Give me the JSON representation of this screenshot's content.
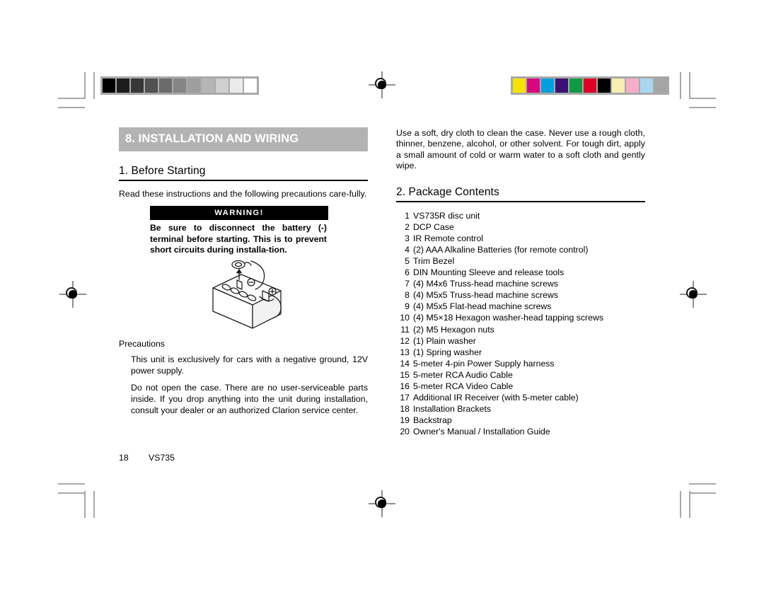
{
  "document": {
    "footer": {
      "page_number": "18",
      "model": "VS735"
    }
  },
  "left_column": {
    "section_band": "8. INSTALLATION AND WIRING",
    "heading": "1. Before Starting",
    "intro": "Read these instructions and the following precautions care-fully.",
    "warning": {
      "title": "WARNING!",
      "text": "Be sure to disconnect the battery (-) terminal before starting. This is to prevent short circuits during installa-tion."
    },
    "illustration_name": "car-battery-disconnect-negative-terminal",
    "precautions_label": "Precautions",
    "precautions": [
      "This unit is exclusively for cars with a negative ground, 12V power supply.",
      "Do not open the case. There are no user-serviceable parts inside. If you drop anything into the unit during installation, consult your dealer or an authorized Clarion service center."
    ]
  },
  "right_column": {
    "cleaning_note": "Use a soft, dry cloth to clean the case. Never use a rough cloth, thinner, benzene, alcohol, or other solvent. For tough dirt, apply a small amount of cold or warm water to a soft cloth and gently wipe.",
    "heading": "2. Package Contents",
    "items": [
      {
        "num": "1",
        "text": "VS735R disc unit"
      },
      {
        "num": "2",
        "text": "DCP Case"
      },
      {
        "num": "3",
        "text": "IR Remote control"
      },
      {
        "num": "4",
        "text": "(2) AAA Alkaline Batteries (for remote control)"
      },
      {
        "num": "5",
        "text": "Trim Bezel"
      },
      {
        "num": "6",
        "text": "DIN Mounting Sleeve and release tools"
      },
      {
        "num": "7",
        "text": "(4) M4x6 Truss-head machine screws"
      },
      {
        "num": "8",
        "text": "(4) M5x5 Truss-head machine screws"
      },
      {
        "num": "9",
        "text": "(4) M5x5 Flat-head machine screws"
      },
      {
        "num": "10",
        "text": "(4) M5×18 Hexagon washer-head tapping screws"
      },
      {
        "num": "11",
        "text": "(2) M5 Hexagon nuts"
      },
      {
        "num": "12",
        "text": "(1) Plain washer"
      },
      {
        "num": "13",
        "text": "(1) Spring washer"
      },
      {
        "num": "14",
        "text": "5-meter 4-pin Power Supply harness"
      },
      {
        "num": "15",
        "text": "5-meter RCA Audio Cable"
      },
      {
        "num": "16",
        "text": "5-meter RCA Video Cable"
      },
      {
        "num": "17",
        "text": "Additional IR Receiver (with 5-meter cable)"
      },
      {
        "num": "18",
        "text": "Installation Brackets"
      },
      {
        "num": "19",
        "text": "Backstrap"
      },
      {
        "num": "20",
        "text": "Owner's Manual / Installation Guide"
      }
    ]
  },
  "printer_marks": {
    "grayscale_strip": [
      "#000000",
      "#1c1c1c",
      "#383838",
      "#525252",
      "#6b6b6b",
      "#858585",
      "#9e9e9e",
      "#b5b5b5",
      "#cfcfcf",
      "#ebebeb",
      "#ffffff"
    ],
    "color_strip": [
      "#f5e400",
      "#d8077f",
      "#00a0df",
      "#3a1273",
      "#0f9b45",
      "#dd0024",
      "#000000",
      "#f7f0b0",
      "#f6aec8",
      "#a8d7f2",
      "#a5a5a5"
    ]
  }
}
